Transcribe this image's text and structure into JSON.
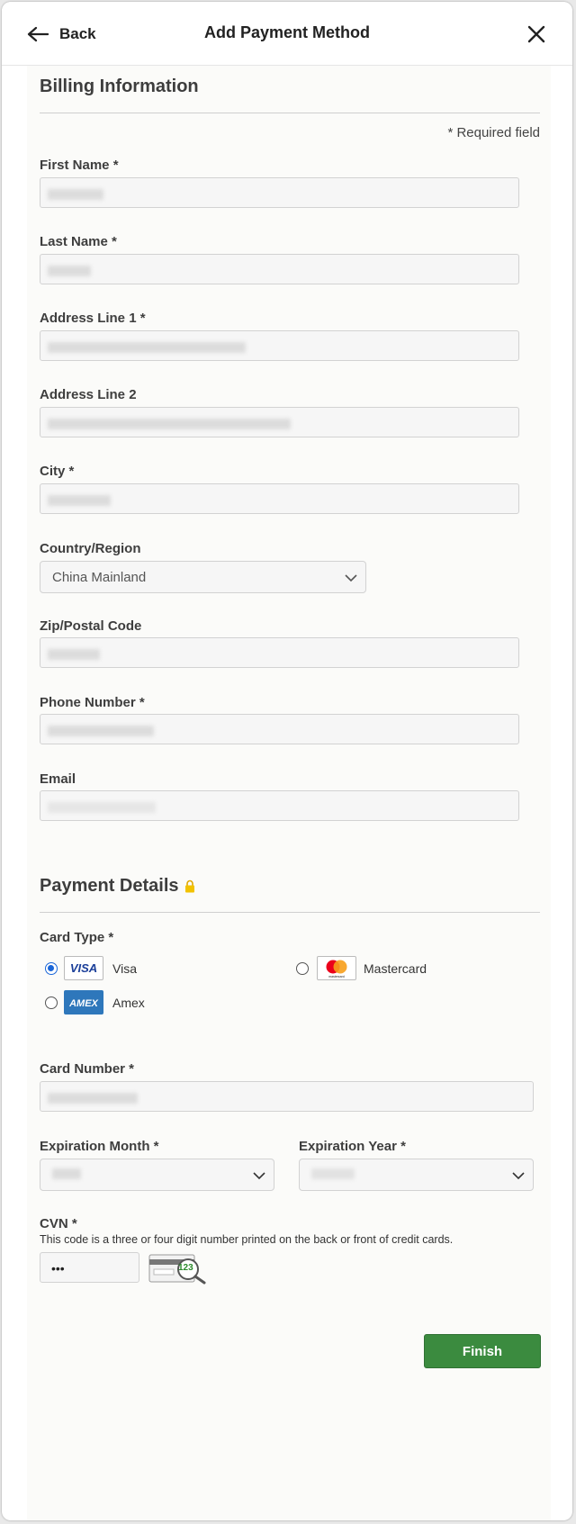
{
  "header": {
    "back_label": "Back",
    "title": "Add Payment Method"
  },
  "billing": {
    "section_title": "Billing Information",
    "required_note": "* Required field",
    "fields": {
      "first_name_label": "First Name *",
      "last_name_label": "Last Name *",
      "address1_label": "Address Line 1 *",
      "address2_label": "Address Line 2",
      "city_label": "City *",
      "country_label": "Country/Region",
      "country_value": "China Mainland",
      "zip_label": "Zip/Postal Code",
      "phone_label": "Phone Number *",
      "email_label": "Email"
    }
  },
  "payment": {
    "section_title": "Payment Details",
    "card_type_label": "Card Type *",
    "card_types": [
      {
        "label": "Visa",
        "logo_text": "VISA",
        "selected": true
      },
      {
        "label": "Mastercard",
        "logo_text": "mastercard",
        "selected": false
      },
      {
        "label": "Amex",
        "logo_text": "AMEX",
        "selected": false
      }
    ],
    "card_number_label": "Card Number *",
    "exp_month_label": "Expiration Month *",
    "exp_year_label": "Expiration Year *",
    "cvn_label": "CVN *",
    "cvn_help": "This code is a three or four digit number printed on the back or front of credit cards.",
    "cvn_value": "•••",
    "cvn_example_digits": "123",
    "finish_label": "Finish"
  },
  "colors": {
    "accent_radio": "#1a66d8",
    "finish_button": "#3b8b3f",
    "lock": "#e6b800"
  },
  "icons": {
    "back": "arrow-left-icon",
    "close": "close-icon",
    "lock": "lock-icon",
    "chevron": "chevron-down-icon"
  }
}
